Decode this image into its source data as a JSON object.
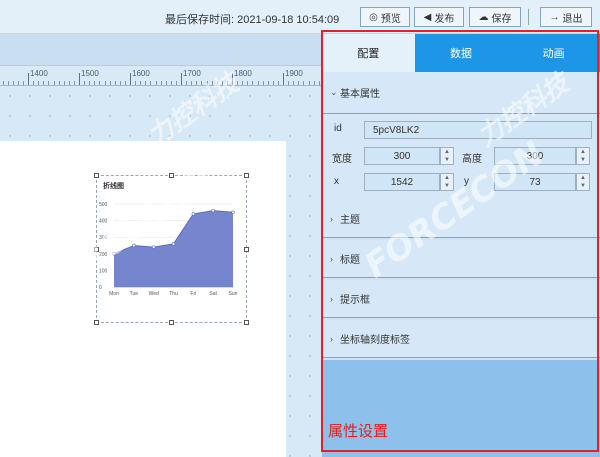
{
  "header": {
    "last_saved_label": "最后保存时间: 2021-09-18 10:54:09",
    "preview_label": "预览",
    "publish_label": "发布",
    "save_label": "保存",
    "exit_label": "退出"
  },
  "ruler": {
    "labels": [
      "1400",
      "1500",
      "1600",
      "1700",
      "1800",
      "1900"
    ]
  },
  "chart_data": {
    "type": "area",
    "title": "折线图",
    "categories": [
      "Mon",
      "Tue",
      "Wed",
      "Thu",
      "Fri",
      "Sat",
      "Sun"
    ],
    "values": [
      200,
      250,
      240,
      260,
      440,
      460,
      450
    ],
    "ylim": [
      0,
      500
    ],
    "yticks": [
      "500",
      "400",
      "300",
      "200",
      "100",
      "0"
    ],
    "colors": {
      "area": "#7586cf",
      "line": "#5a6cc0"
    }
  },
  "panel": {
    "tabs": [
      {
        "label": "配置",
        "active": true
      },
      {
        "label": "数据",
        "active": false
      },
      {
        "label": "动画",
        "active": false
      }
    ],
    "basic_section": "基本属性",
    "fields": {
      "id_label": "id",
      "id_value": "5pcV8LK2",
      "width_label": "宽度",
      "width_value": "300",
      "height_label": "高度",
      "height_value": "300",
      "x_label": "x",
      "x_value": "1542",
      "y_label": "y",
      "y_value": "73"
    },
    "sections": [
      "主题",
      "标题",
      "提示框",
      "坐标轴刻度标签"
    ],
    "annotation": "属性设置"
  },
  "watermark": "FORCECON 力控科技"
}
